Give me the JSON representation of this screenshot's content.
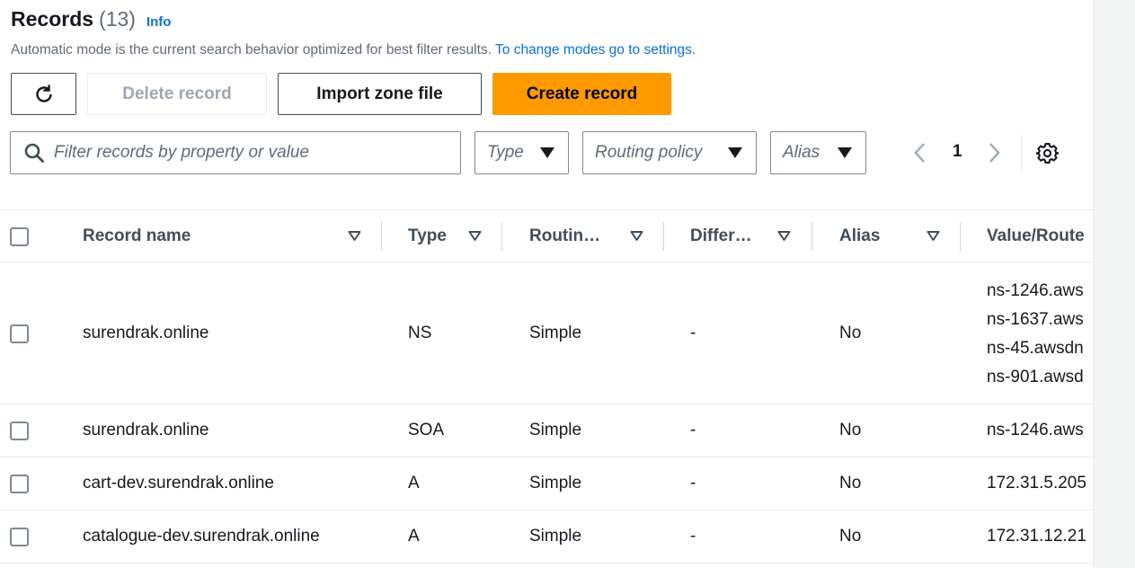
{
  "header": {
    "title": "Records",
    "count": "(13)",
    "info": "Info"
  },
  "description": {
    "text": "Automatic mode is the current search behavior optimized for best filter results. ",
    "link": "To change modes go to settings."
  },
  "toolbar": {
    "delete_label": "Delete record",
    "import_label": "Import zone file",
    "create_label": "Create record"
  },
  "filter": {
    "placeholder": "Filter records by property or value"
  },
  "selects": {
    "type": "Type",
    "routing": "Routing policy",
    "alias": "Alias"
  },
  "pagination": {
    "page": "1"
  },
  "columns": [
    "Record name",
    "Type",
    "Routin…",
    "Differ…",
    "Alias",
    "Value/Route"
  ],
  "rows": [
    {
      "name": "surendrak.online",
      "type": "NS",
      "routing": "Simple",
      "differentiator": "-",
      "alias": "No",
      "values": [
        "ns-1246.aws",
        "ns-1637.aws",
        "ns-45.awsdn",
        "ns-901.awsd"
      ]
    },
    {
      "name": "surendrak.online",
      "type": "SOA",
      "routing": "Simple",
      "differentiator": "-",
      "alias": "No",
      "values": [
        "ns-1246.aws"
      ]
    },
    {
      "name": "cart-dev.surendrak.online",
      "type": "A",
      "routing": "Simple",
      "differentiator": "-",
      "alias": "No",
      "values": [
        "172.31.5.205"
      ]
    },
    {
      "name": "catalogue-dev.surendrak.online",
      "type": "A",
      "routing": "Simple",
      "differentiator": "-",
      "alias": "No",
      "values": [
        "172.31.12.21"
      ]
    }
  ],
  "colors": {
    "primary": "#ff9900",
    "link": "#0972d3",
    "text": "#16191f",
    "muted": "#5f6b7a"
  }
}
